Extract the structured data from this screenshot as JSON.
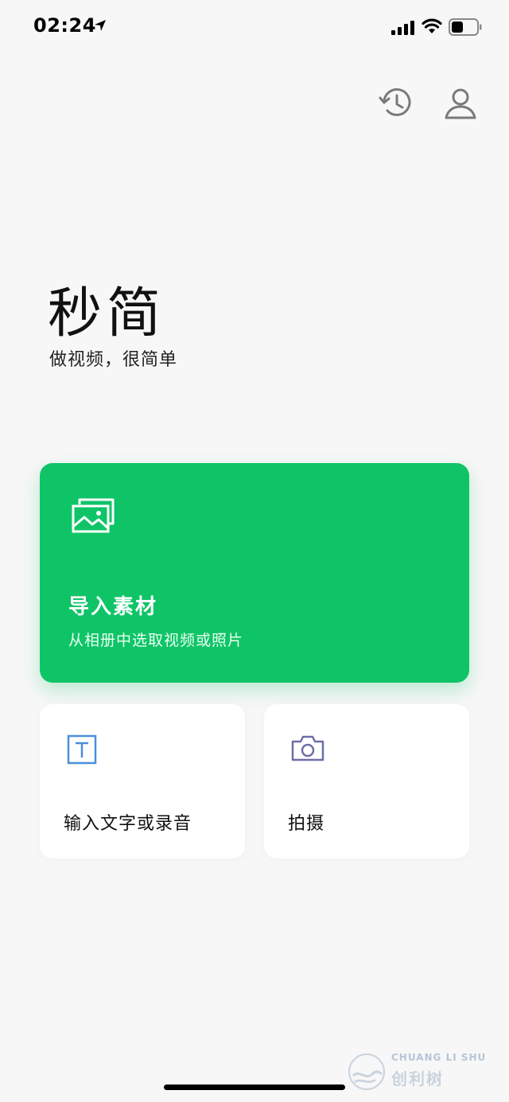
{
  "status": {
    "time": "02:24",
    "icons": [
      "location-arrow-icon",
      "cellular-signal-icon",
      "wifi-icon",
      "battery-icon"
    ]
  },
  "header": {
    "icons": [
      "history-icon",
      "profile-icon"
    ]
  },
  "brand": {
    "logo": "秒简",
    "slogan": "做视频，很简单"
  },
  "import_card": {
    "title": "导入素材",
    "subtitle": "从相册中选取视频或照片",
    "icon": "image-gallery-icon",
    "color": "#0fc467"
  },
  "cards": [
    {
      "label": "输入文字或录音",
      "icon": "text-t-icon",
      "icon_color": "#4a8fd8"
    },
    {
      "label": "拍摄",
      "icon": "camera-icon",
      "icon_color": "#6b6fa8"
    }
  ],
  "watermark": {
    "en": "CHUANG LI SHU",
    "cn": "创利树"
  }
}
